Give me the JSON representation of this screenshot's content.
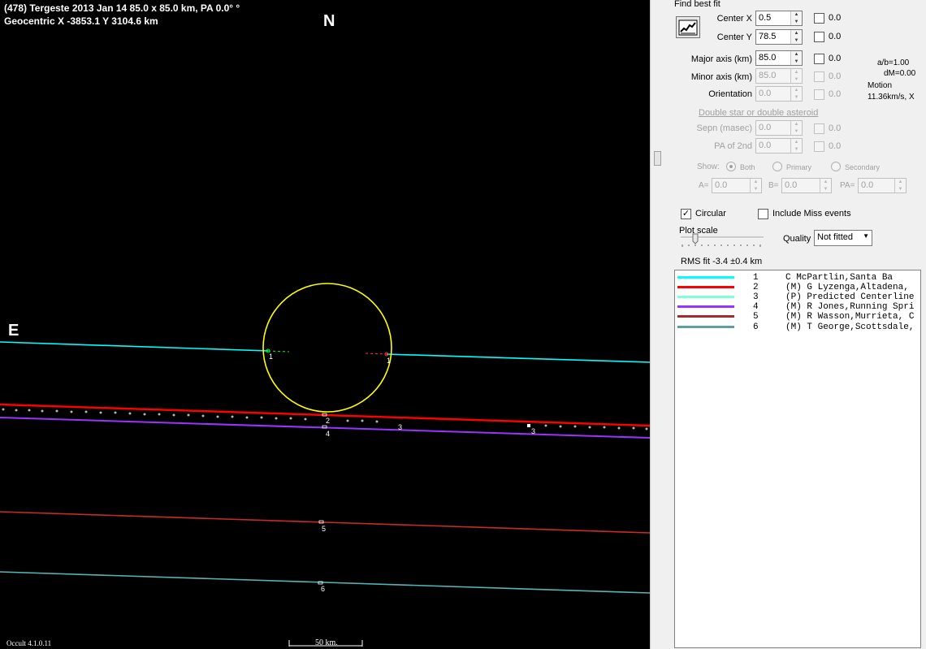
{
  "plot": {
    "title_line1": "(478) Tergeste  2013 Jan 14   85.0 x 85.0 km,  PA 0.0° °",
    "title_line2": "Geocentric  X  -3853.1   Y 3104.6 km",
    "north_label": "N",
    "east_label": "E",
    "version": "Occult 4.1.0.11",
    "scale_label": "50 km.",
    "chord_labels": [
      "1",
      "1",
      "2",
      "3",
      "3",
      "4",
      "5",
      "6"
    ],
    "colors": {
      "background": "#000000",
      "ellipse": "#ffff00",
      "chord1": "#00ffff",
      "chord2": "#ff0000",
      "chord4": "#9933ff",
      "chord5": "#cc2a2a",
      "chord6": "#55b5b5"
    }
  },
  "panel": {
    "find_best_fit": "Find best fit",
    "center_x": {
      "label": "Center X",
      "value": "0.5",
      "chk": "0.0"
    },
    "center_y": {
      "label": "Center Y",
      "value": "78.5",
      "chk": "0.0"
    },
    "major_axis": {
      "label": "Major axis (km)",
      "value": "85.0",
      "chk": "0.0"
    },
    "minor_axis": {
      "label": "Minor axis (km)",
      "value": "85.0",
      "chk": "0.0"
    },
    "orientation": {
      "label": "Orientation",
      "value": "0.0",
      "chk": "0.0"
    },
    "ratio": "a/b=1.00",
    "dm": "dM=0.00",
    "motion_label": "Motion",
    "motion_value": "11.36km/s, X",
    "double_star": "Double star  or  double asteroid",
    "sepn": {
      "label": "Sepn (masec)",
      "value": "0.0",
      "chk": "0.0"
    },
    "pa2nd": {
      "label": "PA of 2nd",
      "value": "0.0",
      "chk": "0.0"
    },
    "show_label": "Show:",
    "show_both": "Both",
    "show_primary": "Primary",
    "show_secondary": "Secondary",
    "a_label": "A=",
    "a_value": "0.0",
    "b_label": "B=",
    "b_value": "0.0",
    "pa_label": "PA=",
    "pa_value": "0.0",
    "circular_label": "Circular",
    "circular_checked": "✓",
    "include_miss_label": "Include Miss events",
    "plot_scale_label": "Plot scale",
    "quality_label": "Quality",
    "quality_value": "Not fitted",
    "rms_fit": "RMS fit -3.4 ±0.4 km"
  },
  "legend": [
    {
      "num": "1",
      "text": "  C McPartlin,Santa Ba",
      "color": "#00ffff"
    },
    {
      "num": "2",
      "text": "(M) G Lyzenga,Altadena,",
      "color": "#ff0000"
    },
    {
      "num": "3",
      "text": "(P) Predicted Centerline",
      "color": "#7fffd4"
    },
    {
      "num": "4",
      "text": "(M) R Jones,Running Spri",
      "color": "#9933ff"
    },
    {
      "num": "5",
      "text": "(M) R Wasson,Murrieta, C",
      "color": "#a52a2a"
    },
    {
      "num": "6",
      "text": "(M) T George,Scottsdale,",
      "color": "#5f9ea0"
    }
  ]
}
